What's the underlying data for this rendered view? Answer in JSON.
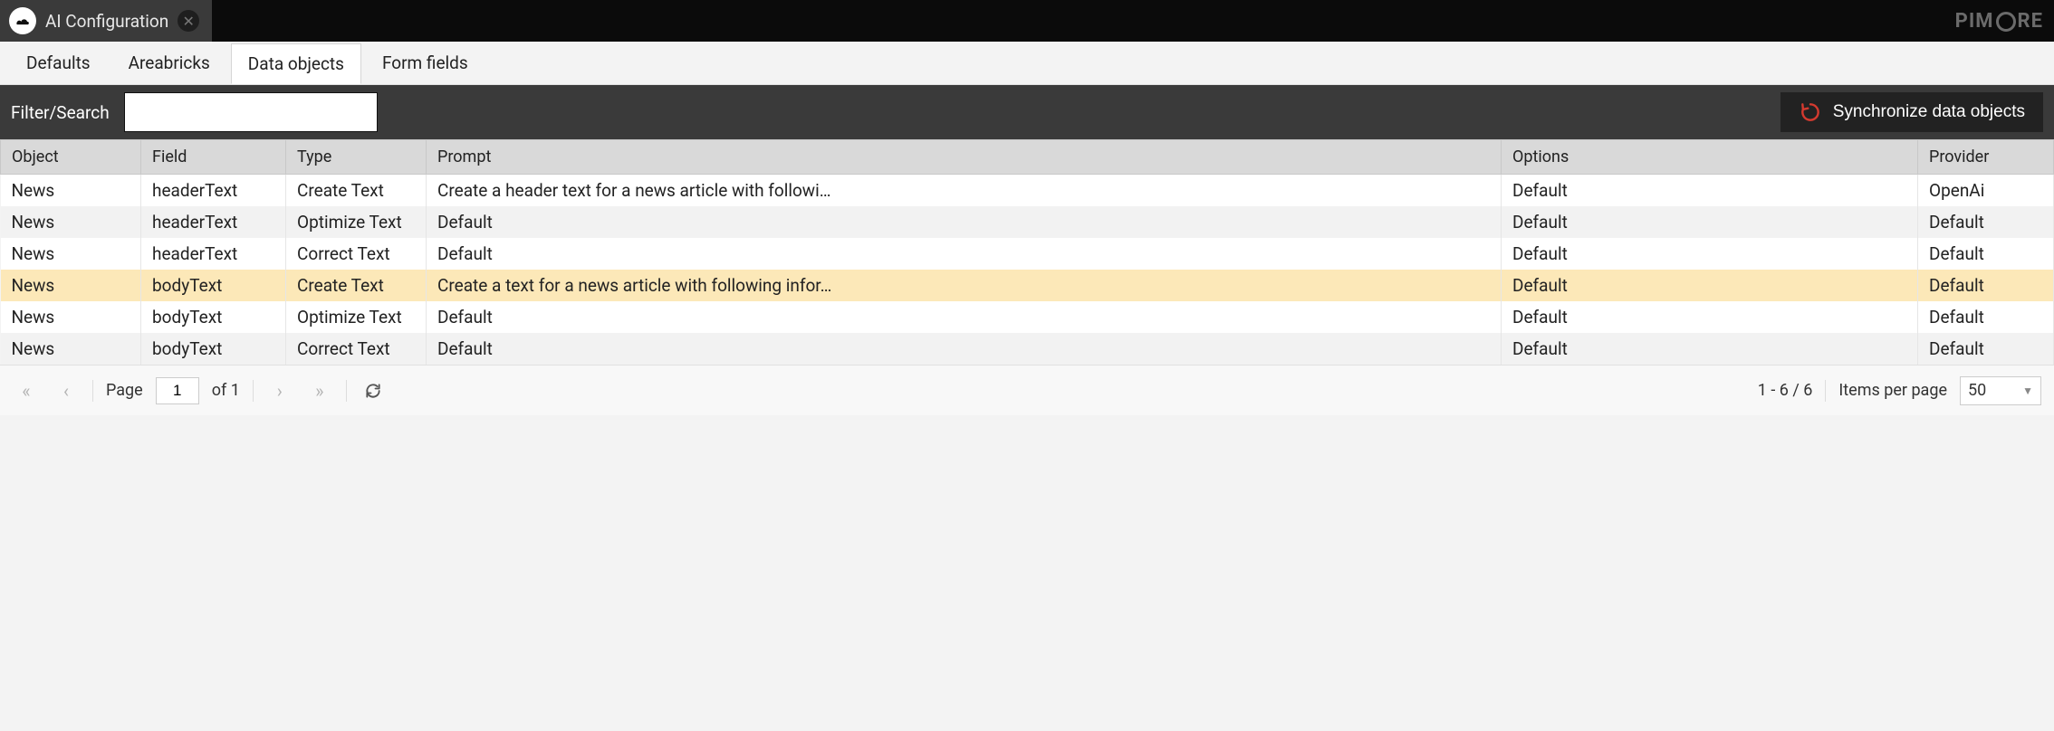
{
  "topbar": {
    "tab_title": "AI Configuration",
    "brand_prefix": "PIM",
    "brand_suffix": "RE"
  },
  "subtabs": {
    "items": [
      {
        "label": "Defaults",
        "active": false
      },
      {
        "label": "Areabricks",
        "active": false
      },
      {
        "label": "Data objects",
        "active": true
      },
      {
        "label": "Form fields",
        "active": false
      }
    ]
  },
  "toolbar": {
    "filter_label": "Filter/Search",
    "search_value": "",
    "sync_label": "Synchronize data objects"
  },
  "table": {
    "columns": [
      "Object",
      "Field",
      "Type",
      "Prompt",
      "Options",
      "Provider"
    ],
    "rows": [
      {
        "object": "News",
        "field": "headerText",
        "type": "Create Text",
        "prompt": "Create a header text for a news article with followi…",
        "options": "Default",
        "provider": "OpenAi",
        "highlight": false
      },
      {
        "object": "News",
        "field": "headerText",
        "type": "Optimize Text",
        "prompt": "Default",
        "options": "Default",
        "provider": "Default",
        "highlight": false
      },
      {
        "object": "News",
        "field": "headerText",
        "type": "Correct Text",
        "prompt": "Default",
        "options": "Default",
        "provider": "Default",
        "highlight": false
      },
      {
        "object": "News",
        "field": "bodyText",
        "type": "Create Text",
        "prompt": "Create a text for a news article with following infor…",
        "options": "Default",
        "provider": "Default",
        "highlight": true
      },
      {
        "object": "News",
        "field": "bodyText",
        "type": "Optimize Text",
        "prompt": "Default",
        "options": "Default",
        "provider": "Default",
        "highlight": false
      },
      {
        "object": "News",
        "field": "bodyText",
        "type": "Correct Text",
        "prompt": "Default",
        "options": "Default",
        "provider": "Default",
        "highlight": false
      }
    ]
  },
  "paging": {
    "page_label": "Page",
    "page_value": "1",
    "of_label": "of 1",
    "range_label": "1 - 6 / 6",
    "ipp_label": "Items per page",
    "ipp_value": "50"
  }
}
